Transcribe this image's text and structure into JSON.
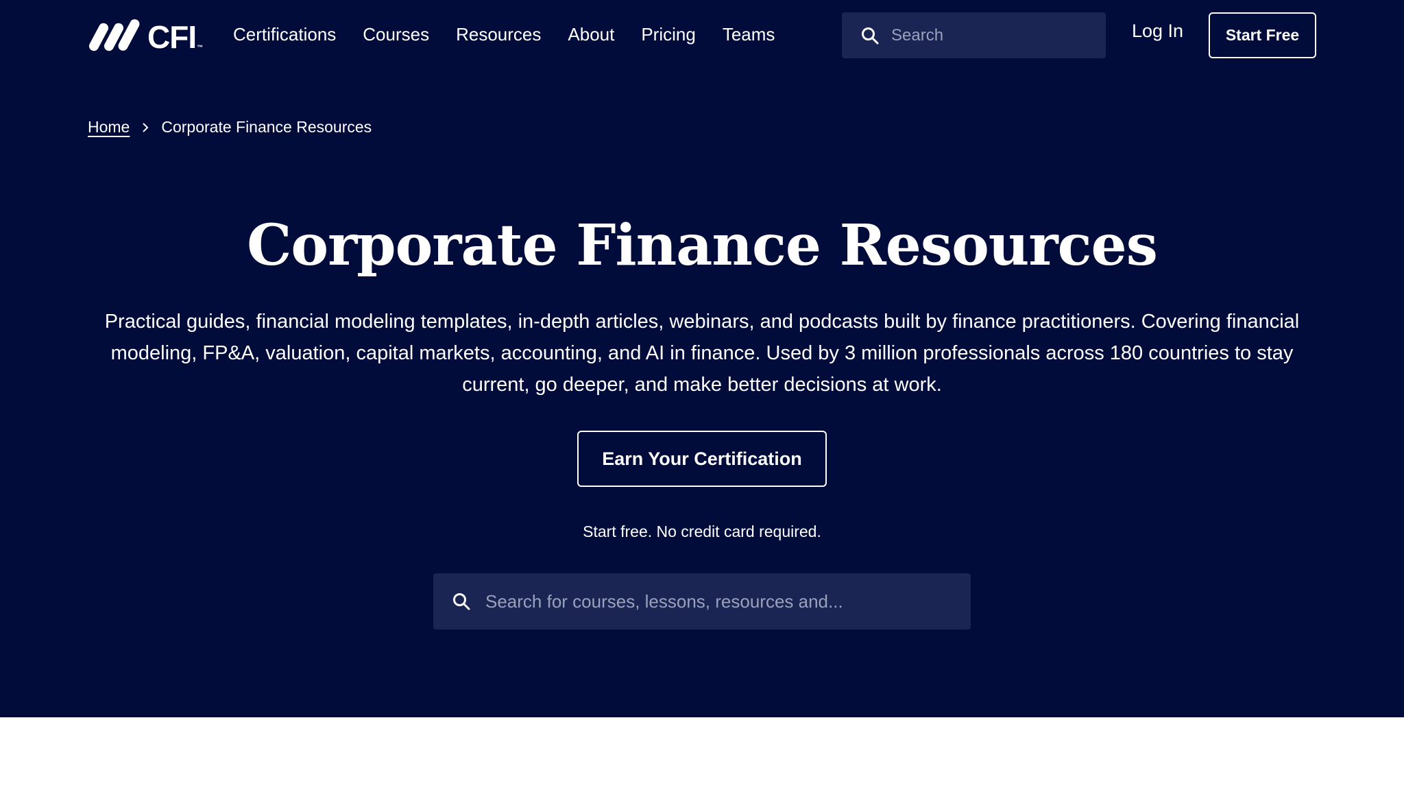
{
  "brand": {
    "name": "CFI",
    "trademark": "™",
    "logo_icon": "cfi-slashes-logo"
  },
  "nav": {
    "items": [
      {
        "label": "Certifications"
      },
      {
        "label": "Courses"
      },
      {
        "label": "Resources"
      },
      {
        "label": "About"
      },
      {
        "label": "Pricing"
      },
      {
        "label": "Teams"
      }
    ],
    "search": {
      "placeholder": "Search",
      "icon": "search-icon"
    },
    "login_label": "Log In",
    "start_free_label": "Start Free"
  },
  "breadcrumb": {
    "home": "Home",
    "separator_icon": "chevron-right-icon",
    "current": "Corporate Finance Resources"
  },
  "hero": {
    "title": "Corporate Finance Resources",
    "description": "Practical guides, financial modeling templates, in-depth articles, webinars, and podcasts built by finance practitioners. Covering financial modeling, FP&A, valuation, capital markets, accounting, and AI in finance. Used by 3 million professionals across 180 countries to stay current, go deeper, and make better decisions at work.",
    "cta_label": "Earn Your Certification",
    "cta_note": "Start free. No credit card required.",
    "search": {
      "placeholder": "Search for courses, lessons, resources and...",
      "icon": "search-icon"
    }
  },
  "colors": {
    "hero_background": "#020c3b",
    "search_background": "#1b2554",
    "text": "#ffffff",
    "placeholder": "#9aa1bb",
    "page_background": "#ffffff"
  }
}
